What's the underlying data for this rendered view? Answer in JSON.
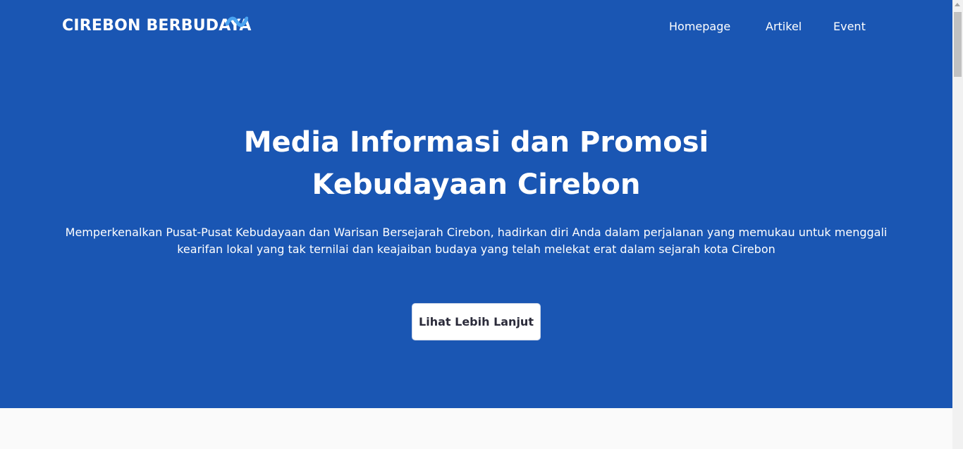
{
  "colors": {
    "hero_background": "#1a56b3",
    "brand_wave": "#4aa3f0",
    "text": "#ffffff",
    "button_background": "#ffffff",
    "button_text": "#2b2b3a",
    "page_background": "#fafafa"
  },
  "navbar": {
    "brand": "CIREBON BERBUDAYA",
    "brand_icon": "wave-icon",
    "links": [
      "Homepage",
      "Artikel",
      "Event"
    ]
  },
  "hero": {
    "title_line1": "Media Informasi dan Promosi",
    "title_line2": "Kebudayaan Cirebon",
    "description_line1": "Memperkenalkan Pusat-Pusat Kebudayaan dan Warisan Bersejarah Cirebon, hadirkan diri Anda dalam perjalanan yang memukau untuk menggali",
    "description_line2": "kearifan lokal yang tak ternilai dan keajaiban budaya yang telah melekat erat dalam sejarah kota Cirebon",
    "cta_label": "Lihat Lebih Lanjut"
  }
}
